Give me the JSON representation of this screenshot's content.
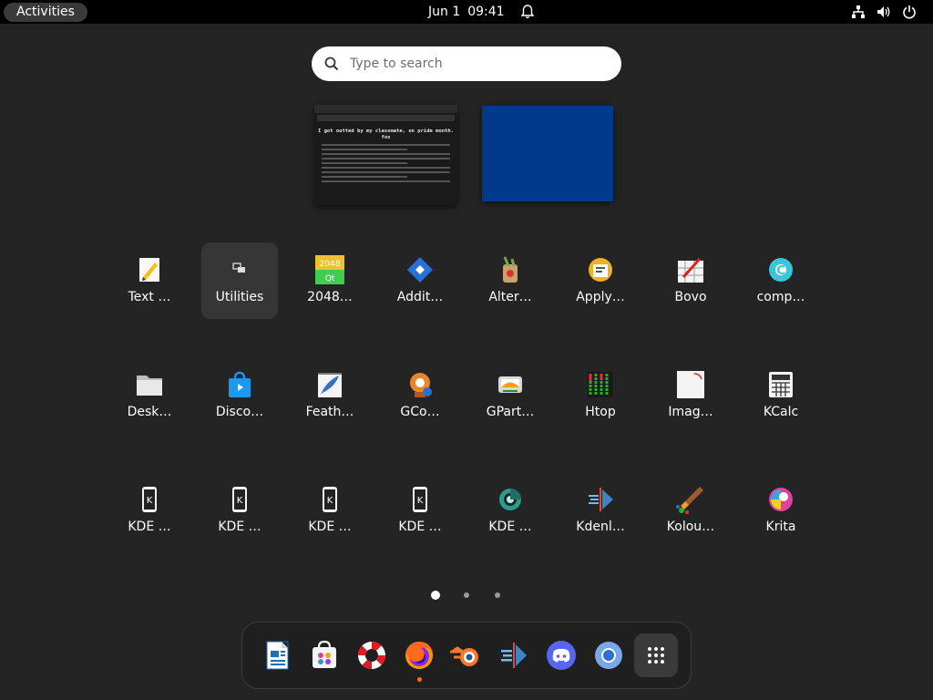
{
  "topbar": {
    "activities_label": "Activities",
    "date": "Jun 1",
    "time": "09:41"
  },
  "search": {
    "placeholder": "Type to search"
  },
  "apps": [
    {
      "label": "Text …",
      "icon": "text-editor-icon"
    },
    {
      "label": "Utilities",
      "icon": "utilities-folder-icon",
      "selected": true
    },
    {
      "label": "2048…",
      "icon": "2048-qt-icon"
    },
    {
      "label": "Addit…",
      "icon": "additional-drivers-icon"
    },
    {
      "label": "Alter…",
      "icon": "alternatives-config-icon"
    },
    {
      "label": "Apply…",
      "icon": "apply-theme-icon"
    },
    {
      "label": "Bovo",
      "icon": "bovo-icon"
    },
    {
      "label": "comp…",
      "icon": "compiz-config-icon"
    },
    {
      "label": "Desk…",
      "icon": "desktop-folder-icon"
    },
    {
      "label": "Disco…",
      "icon": "discover-store-icon"
    },
    {
      "label": "Feath…",
      "icon": "feather-notes-icon"
    },
    {
      "label": "GCo…",
      "icon": "gcompris-icon"
    },
    {
      "label": "GPart…",
      "icon": "gparted-icon"
    },
    {
      "label": "Htop",
      "icon": "htop-icon"
    },
    {
      "label": "Imag…",
      "icon": "image-viewer-icon"
    },
    {
      "label": "KCalc",
      "icon": "kcalc-icon"
    },
    {
      "label": "KDE …",
      "icon": "kde-connect-icon"
    },
    {
      "label": "KDE …",
      "icon": "kde-connect-icon"
    },
    {
      "label": "KDE …",
      "icon": "kde-connect-icon"
    },
    {
      "label": "KDE …",
      "icon": "kde-connect-icon"
    },
    {
      "label": "KDE …",
      "icon": "kde-partition-icon"
    },
    {
      "label": "Kdenl…",
      "icon": "kdenlive-icon"
    },
    {
      "label": "Kolou…",
      "icon": "kolourpaint-icon"
    },
    {
      "label": "Krita",
      "icon": "krita-icon"
    }
  ],
  "pages": {
    "count": 3,
    "current": 1
  },
  "dock": [
    {
      "name": "libreoffice-writer-icon"
    },
    {
      "name": "software-store-icon"
    },
    {
      "name": "help-lifebuoy-icon"
    },
    {
      "name": "firefox-icon",
      "running": true
    },
    {
      "name": "blender-icon"
    },
    {
      "name": "kdenlive-dock-icon"
    },
    {
      "name": "discord-icon"
    },
    {
      "name": "chromium-icon"
    }
  ],
  "window_thumb": {
    "title_line1": "I got outted by my classmate, on pride month.",
    "title_line2": "fox"
  },
  "colors": {
    "background": "#242424",
    "topbar": "#000000",
    "accent_blue": "#003a8c"
  }
}
